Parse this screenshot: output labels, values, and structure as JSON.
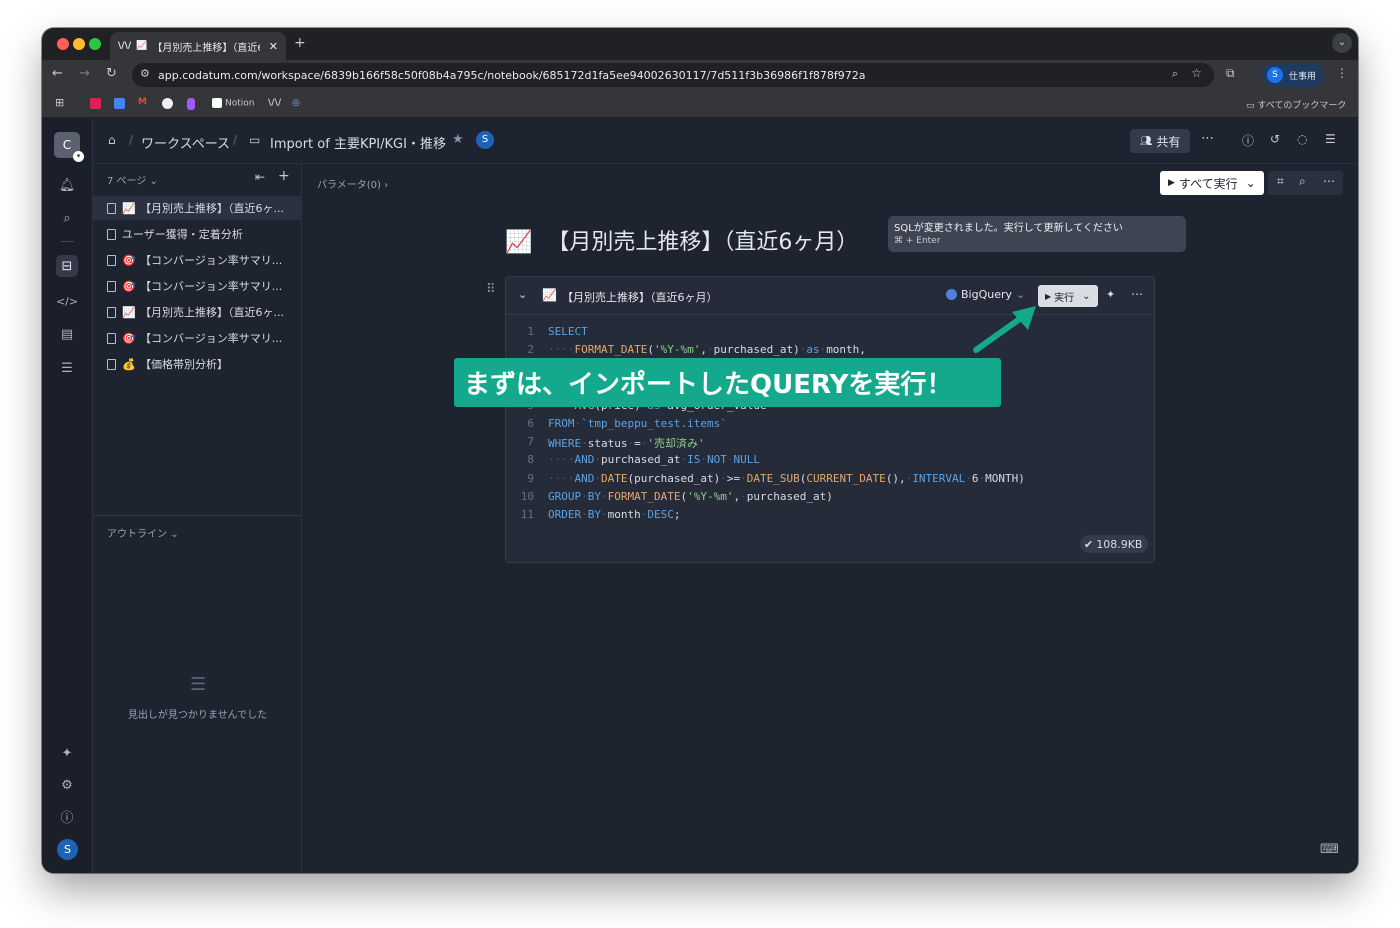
{
  "browser": {
    "tab_title": "【月別売上推移】（直近6ヶ月）",
    "new_tab": "+",
    "url": "app.codatum.com/workspace/6839b166f58c50f08b4a795c/notebook/685172d1fa5ee94002630117/7d511f3b36986f1f878f972a",
    "profile_initial": "S",
    "profile_label": "仕事用",
    "bookmark_notion": "Notion",
    "bookmark_all": "すべてのブックマーク"
  },
  "rail": {
    "workspace_initial": "C",
    "user_initial": "S"
  },
  "header": {
    "breadcrumb_workspace": "ワークスペース",
    "breadcrumb_sep": "/",
    "notebook_title": "Import of 主要KPI/KGI・推移",
    "avatar_initial": "S",
    "share_label": "共有"
  },
  "sidebar": {
    "pages_count": "7 ページ",
    "pages": [
      {
        "emoji": "📈",
        "label": "【月別売上推移】（直近6ヶ..."
      },
      {
        "emoji": "",
        "label": "ユーザー獲得・定着分析"
      },
      {
        "emoji": "🎯",
        "label": "【コンバージョン率サマリ..."
      },
      {
        "emoji": "🎯",
        "label": "【コンバージョン率サマリ..."
      },
      {
        "emoji": "📈",
        "label": "【月別売上推移】（直近6ヶ..."
      },
      {
        "emoji": "🎯",
        "label": "【コンバージョン率サマリ..."
      },
      {
        "emoji": "💰",
        "label": "【価格帯別分析】"
      }
    ],
    "outline_label": "アウトライン",
    "outline_empty": "見出しが見つかりませんでした"
  },
  "main": {
    "params_label": "パラメータ(0)",
    "run_all_label": "すべて実行",
    "page_emoji": "📈",
    "page_title": "【月別売上推移】（直近6ヶ月）"
  },
  "cell": {
    "emoji": "📈",
    "title": "【月別売上推移】（直近6ヶ月）",
    "datasource": "BigQuery",
    "run_label": "実行",
    "size_badge": "108.9KB"
  },
  "tooltip": {
    "message": "SQLが変更されました。実行して更新してください",
    "shortcut": "⌘ + Enter"
  },
  "callout": {
    "text": "まずは、インポートしたQUERYを実行！",
    "color": "#14a88c"
  },
  "code_lines": [
    {
      "n": "1",
      "text": "SELECT"
    },
    {
      "n": "2",
      "text": "····FORMAT_DATE('%Y-%m',·purchased_at)·as·month,"
    },
    {
      "n": "5",
      "text": "····AVG(price)·as·avg_order_value"
    },
    {
      "n": "6",
      "text": "FROM·`tmp_beppu_test.items`"
    },
    {
      "n": "7",
      "text": "WHERE·status·=·'売却済み'"
    },
    {
      "n": "8",
      "text": "····AND·purchased_at·IS·NOT·NULL"
    },
    {
      "n": "9",
      "text": "····AND·DATE(purchased_at)·>=·DATE_SUB(CURRENT_DATE(),·INTERVAL·6·MONTH)"
    },
    {
      "n": "10",
      "text": "GROUP·BY·FORMAT_DATE('%Y-%m',·purchased_at)"
    },
    {
      "n": "11",
      "text": "ORDER·BY·month·DESC;"
    }
  ]
}
